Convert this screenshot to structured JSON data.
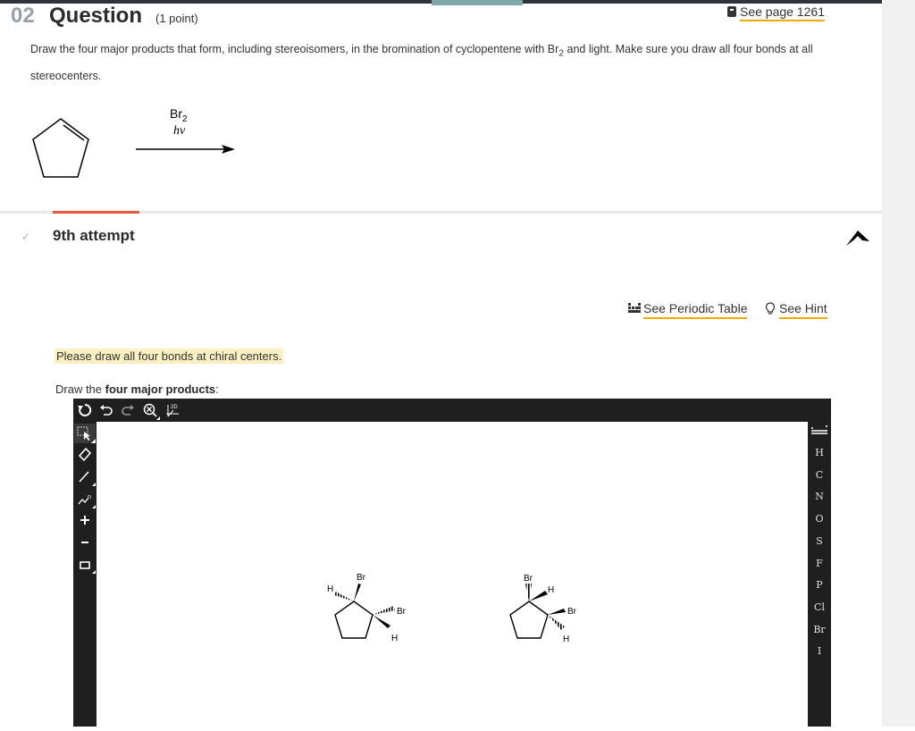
{
  "header": {
    "question_number": "02",
    "question_title": "Question",
    "points": "(1 point)",
    "see_page": "See page 1261"
  },
  "prompt": {
    "part1": "Draw the four major products that form, including stereoisomers, in the bromination of cyclopentene with Br",
    "sub2": "2",
    "part2": " and light. Make sure you draw all four bonds at all stereocenters."
  },
  "reaction": {
    "reagent_main": "Br",
    "reagent_sub": "2",
    "condition": "hν"
  },
  "attempt": {
    "label": "9th attempt"
  },
  "tools": {
    "periodic_table": "See Periodic Table",
    "hint": "See Hint"
  },
  "notice": "Please draw all four bonds at chiral centers.",
  "draw_label": {
    "prefix": "Draw the ",
    "bold": "four major products",
    "suffix": ":"
  },
  "editor": {
    "top_tools": [
      "clear-icon",
      "undo-icon",
      "redo-icon",
      "zoom-icon",
      "2d-clean-icon"
    ],
    "clean_label": "2D",
    "left_tools": [
      "select-icon",
      "eraser-icon",
      "bond-icon",
      "chain-icon",
      "plus-charge-icon",
      "minus-charge-icon",
      "ring-icon"
    ],
    "elements": [
      "H",
      "C",
      "N",
      "O",
      "S",
      "F",
      "P",
      "Cl",
      "Br",
      "I"
    ]
  },
  "molecules": [
    {
      "labels": {
        "br_top": "Br",
        "h_left": "H",
        "br_right": "Br",
        "h_bottom": "H"
      }
    },
    {
      "labels": {
        "br_top": "Br",
        "h_right": "H",
        "br_right": "Br",
        "h_bottom": "H"
      }
    }
  ],
  "colors": {
    "accent_orange": "#f2a900",
    "accent_red": "#e8563f",
    "editor_dark": "#1f1f1f",
    "notice_bg": "#fbf0c2"
  }
}
